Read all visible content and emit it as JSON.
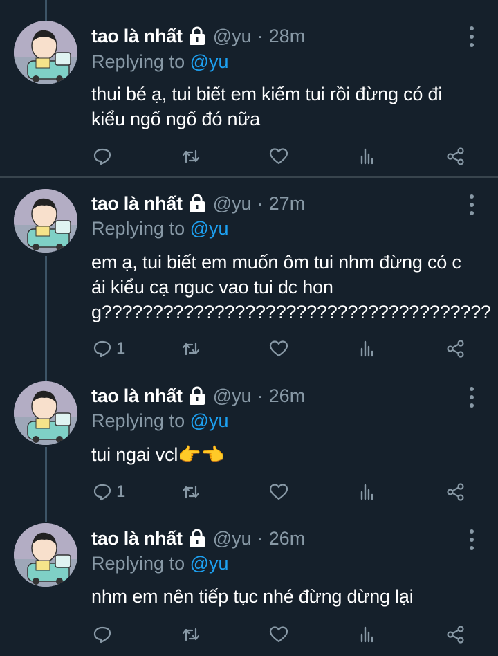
{
  "tweets": [
    {
      "name": "tao là nhất",
      "handle": "@yu",
      "sep": "·",
      "time": "28m",
      "replying_prefix": "Replying to",
      "replying_to": "@yu",
      "text": "thui bé ạ, tui biết em kiếm tui rồi đừng có đi kiểu ngố ngố đó nữa",
      "reply_count": ""
    },
    {
      "name": "tao là nhất",
      "handle": "@yu",
      "sep": "·",
      "time": "27m",
      "replying_prefix": "Replying to",
      "replying_to": "@yu",
      "text": "em ạ, tui biết em muốn ôm tui nhm đừng có cái kiểu cạ nguc vao tui dc hong??????????????????????????????????????",
      "reply_count": "1"
    },
    {
      "name": "tao là nhất",
      "handle": "@yu",
      "sep": "·",
      "time": "26m",
      "replying_prefix": "Replying to",
      "replying_to": "@yu",
      "text": "tui ngai vcl👉👈",
      "reply_count": "1"
    },
    {
      "name": "tao là nhất",
      "handle": "@yu",
      "sep": "·",
      "time": "26m",
      "replying_prefix": "Replying to",
      "replying_to": "@yu",
      "text": "nhm em nên tiếp tục nhé đừng dừng lại",
      "reply_count": ""
    }
  ],
  "colors": {
    "background": "#15202b",
    "secondary_text": "#8899a6",
    "mention": "#1da1f2",
    "divider": "#38444d"
  },
  "icons": [
    "lock-icon",
    "more-icon",
    "reply-icon",
    "retweet-icon",
    "like-icon",
    "analytics-icon",
    "share-icon"
  ]
}
